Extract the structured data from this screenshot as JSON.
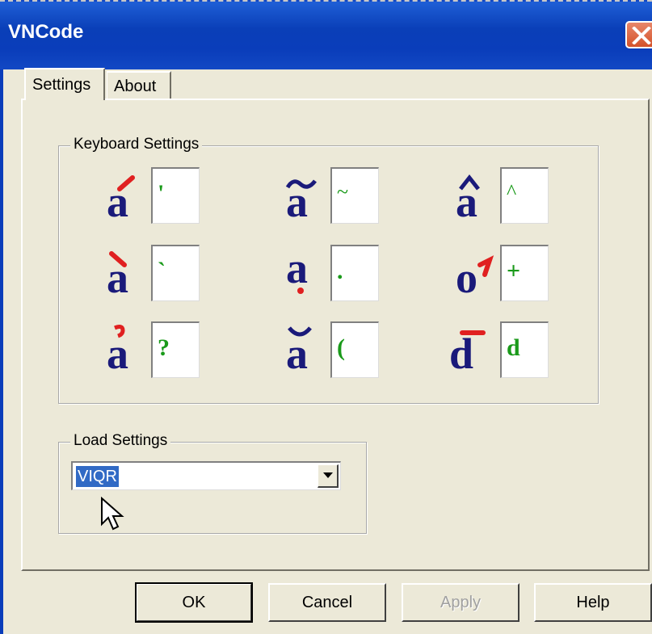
{
  "window": {
    "title": "VNCode"
  },
  "tabs": [
    {
      "label": "Settings",
      "selected": true
    },
    {
      "label": "About",
      "selected": false
    }
  ],
  "keyboard_settings": {
    "legend": "Keyboard Settings",
    "items": [
      {
        "glyph": "á",
        "key": "'"
      },
      {
        "glyph": "ã",
        "key": "~"
      },
      {
        "glyph": "â",
        "key": "^"
      },
      {
        "glyph": "à",
        "key": "`"
      },
      {
        "glyph": "ạ",
        "key": "."
      },
      {
        "glyph": "ơ",
        "key": "+"
      },
      {
        "glyph": "ả",
        "key": "?"
      },
      {
        "glyph": "ă",
        "key": "("
      },
      {
        "glyph": "đ",
        "key": "d"
      }
    ]
  },
  "load_settings": {
    "legend": "Load Settings",
    "selected": "VIQR"
  },
  "buttons": {
    "ok": "OK",
    "cancel": "Cancel",
    "apply": "Apply",
    "help": "Help"
  },
  "colors": {
    "glyph_base": "#1a1a7a",
    "glyph_accent": "#e02020",
    "key_text": "#1a9a1a",
    "titlebar": "#0a3dba"
  }
}
